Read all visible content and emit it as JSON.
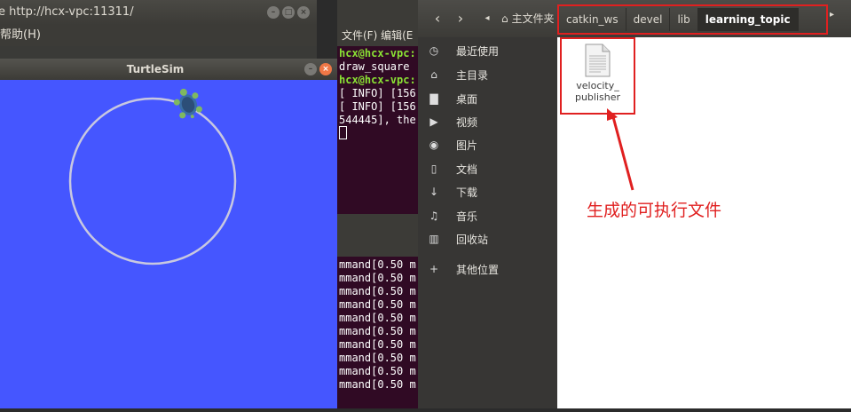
{
  "bg_terminal": {
    "title": "e http://hcx-vpc:11311/",
    "menu_help": "帮助(H)"
  },
  "turtlesim": {
    "title": "TurtleSim"
  },
  "terminal": {
    "menu": "文件(F)  编辑(E",
    "lines": [
      "hcx@hcx-vpc:",
      "draw_square",
      "hcx@hcx-vpc:",
      "[ INFO] [156",
      "[ INFO] [156",
      "544445], the"
    ],
    "command_lines": [
      "mmand[0.50 m",
      "mmand[0.50 m",
      "mmand[0.50 m",
      "mmand[0.50 m",
      "mmand[0.50 m",
      "mmand[0.50 m",
      "mmand[0.50 m",
      "mmand[0.50 m",
      "mmand[0.50 m",
      "mmand[0.50 m"
    ]
  },
  "file_manager": {
    "home_label": "主文件夹",
    "breadcrumbs": [
      "catkin_ws",
      "devel",
      "lib",
      "learning_topic"
    ],
    "sidebar": [
      {
        "icon": "clock-icon",
        "label": "最近使用"
      },
      {
        "icon": "home-icon",
        "label": "主目录"
      },
      {
        "icon": "folder-icon",
        "label": "桌面"
      },
      {
        "icon": "video-icon",
        "label": "视频"
      },
      {
        "icon": "camera-icon",
        "label": "图片"
      },
      {
        "icon": "document-icon",
        "label": "文档"
      },
      {
        "icon": "download-icon",
        "label": "下载"
      },
      {
        "icon": "music-icon",
        "label": "音乐"
      },
      {
        "icon": "trash-icon",
        "label": "回收站"
      },
      {
        "icon": "plus-icon",
        "label": "其他位置"
      }
    ],
    "file": {
      "name_line1": "velocity_",
      "name_line2": "publisher"
    }
  },
  "annotation": "生成的可执行文件",
  "colors": {
    "turtle_bg": "#4556ff",
    "terminal_bg": "#300a24",
    "highlight": "#e02020"
  }
}
